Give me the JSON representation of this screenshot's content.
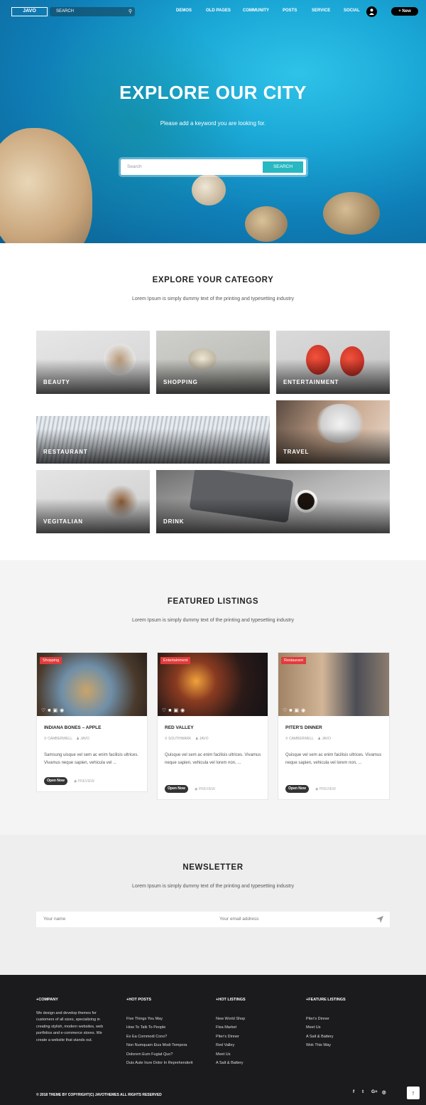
{
  "nav": {
    "logo": "JAVO",
    "search_placeholder": "SEARCH",
    "menu": [
      "DEMOS",
      "OLD PAGES",
      "COMMUNITY",
      "POSTS",
      "SERVICE",
      "SOCIAL"
    ],
    "new_label": "New"
  },
  "hero": {
    "title": "EXPLORE OUR CITY",
    "subtitle": "Please add a keyword you are looking for.",
    "search_placeholder": "Search",
    "search_button": "SEARCH"
  },
  "categories": {
    "title": "EXPLORE YOUR CATEGORY",
    "subtitle": "Lorem Ipsum is simply dummy text of the printing and typesetting industry",
    "tiles": [
      "BEAUTY",
      "SHOPPING",
      "ENTERTAINMENT",
      "RESTAURANT",
      "TRAVEL",
      "VEGITALIAN",
      "DRINK"
    ]
  },
  "featured": {
    "title": "FEATURED LISTINGS",
    "subtitle": "Lorem Ipsum is simply dummy text of the printing and typesetting industry",
    "cards": [
      {
        "tag": "Shopping",
        "name": "INDIANA BONES – APPLE",
        "location": "CAMBERWELL",
        "author": "JAVO",
        "desc": "Samsung uisque vel sem ac enim facilisis ultrices. Vivamus neque sapien, vehicula vel ...",
        "open": "Open Now",
        "preview": "PREVIEW"
      },
      {
        "tag": "Entertainment",
        "name": "RED VALLEY",
        "location": "SOUTHWARK",
        "author": "JAVO",
        "desc": "Quisque vel sem ac enim facilisis ultrices. Vivamus neque sapien, vehicula vel lorem non, ...",
        "open": "Open Now",
        "preview": "PREVIEW"
      },
      {
        "tag": "Restaurant",
        "name": "PITER'S DINNER",
        "location": "CAMBERWELL",
        "author": "JAVO",
        "desc": "Quisque vel sem ac enim facilisis ultrices. Vivamus neque sapien, vehicula vel lorem non, ...",
        "open": "Open Now",
        "preview": "PREVIEW"
      }
    ]
  },
  "newsletter": {
    "title": "NEWSLETTER",
    "subtitle": "Lorem Ipsum is simply dummy text of the printing and typesetting industry",
    "name_placeholder": "Your name",
    "email_placeholder": "Your email address"
  },
  "footer": {
    "company_head": "COMPANY",
    "company_text": "We design and develop themes for customers of all sizes, specializing in creating stylish, modern websites, web portfolios and e-commerce stores. We create a website that stands out.",
    "hot_posts_head": "HOT POSTS",
    "hot_posts": [
      "Five Things You May",
      "How To Talk To People",
      "Ex Ea Commodi Cons?",
      "Non Numquam Eius Modi Tempora",
      "Dolorem Eum Fugiat Quo?",
      "Duis Aute Irure Dolor In Reprehenderit"
    ],
    "hot_listings_head": "HOT LISTINGS",
    "hot_listings": [
      "New World Shop",
      "Flea Market",
      "Piter's Dinner",
      "Red Valley",
      "Meet Us",
      "A Salt & Battery"
    ],
    "feature_head": "FEATURE LISTINGS",
    "feature_listings": [
      "Piter's Dinner",
      "Meet Us",
      "A Salt & Battery",
      "Wok This Way"
    ],
    "copyright": "© 2018 THEME BY COPYRIGHT(C) JAVOTHEMES ALL RIGHTS RESERVED",
    "social": [
      "f",
      "t",
      "G+",
      "◎"
    ]
  },
  "colors": {
    "accent": "#27b8c2",
    "tag": "#e23b3b",
    "footer": "#1b1b1d"
  }
}
